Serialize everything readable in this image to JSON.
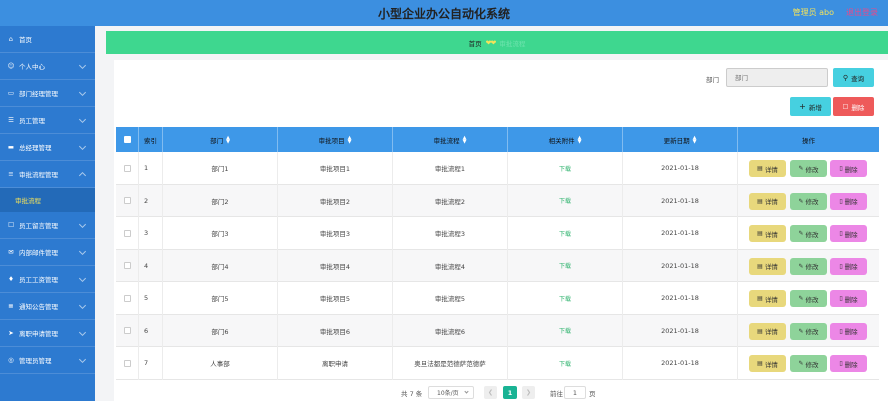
{
  "header": {
    "title": "小型企业办公自动化系统",
    "user": "管理员 abo",
    "logout": "退出登录"
  },
  "sidebar": {
    "items": [
      {
        "label": "首页",
        "icon": "home-icon"
      },
      {
        "label": "个人中心",
        "icon": "user-icon"
      },
      {
        "label": "部门经理管理",
        "icon": "folder-icon"
      },
      {
        "label": "员工管理",
        "icon": "staff-icon"
      },
      {
        "label": "总经理管理",
        "icon": "manager-icon"
      },
      {
        "label": "审批流程管理",
        "icon": "list-icon"
      },
      {
        "label": "员工留言管理",
        "icon": "message-icon"
      },
      {
        "label": "内部邮件管理",
        "icon": "mail-icon"
      },
      {
        "label": "员工工资管理",
        "icon": "salary-icon"
      },
      {
        "label": "通知公告管理",
        "icon": "notice-icon"
      },
      {
        "label": "离职申请管理",
        "icon": "leave-icon"
      },
      {
        "label": "管理员管理",
        "icon": "admin-icon"
      }
    ],
    "sub_item": "审批流程"
  },
  "breadcrumb": {
    "home": "首页",
    "current": "审批流程"
  },
  "search": {
    "label": "部门",
    "placeholder": "部门",
    "button": "查询"
  },
  "actions": {
    "add": "新增",
    "delete": "删除"
  },
  "table": {
    "columns": [
      "索引",
      "部门",
      "审批项目",
      "审批流程",
      "相关附件",
      "更新日期",
      "操作"
    ],
    "rows": [
      {
        "index": "1",
        "dept": "部门1",
        "item": "审批项目1",
        "flow": "审批流程1",
        "file": "下载",
        "date": "2021-01-18"
      },
      {
        "index": "2",
        "dept": "部门2",
        "item": "审批项目2",
        "flow": "审批流程2",
        "file": "下载",
        "date": "2021-01-18"
      },
      {
        "index": "3",
        "dept": "部门3",
        "item": "审批项目3",
        "flow": "审批流程3",
        "file": "下载",
        "date": "2021-01-18"
      },
      {
        "index": "4",
        "dept": "部门4",
        "item": "审批项目4",
        "flow": "审批流程4",
        "file": "下载",
        "date": "2021-01-18"
      },
      {
        "index": "5",
        "dept": "部门5",
        "item": "审批项目5",
        "flow": "审批流程5",
        "file": "下载",
        "date": "2021-01-18"
      },
      {
        "index": "6",
        "dept": "部门6",
        "item": "审批项目6",
        "flow": "审批流程6",
        "file": "下载",
        "date": "2021-01-18"
      },
      {
        "index": "7",
        "dept": "人事部",
        "item": "离职申请",
        "flow": "奥旦法都是范德萨范德萨",
        "file": "下载",
        "date": "2021-01-18"
      }
    ],
    "row_buttons": {
      "detail": "详情",
      "edit": "修改",
      "delete": "删除"
    }
  },
  "pagination": {
    "total": "共 7 条",
    "page_size": "10条/页",
    "current": "1",
    "goto_prefix": "前往",
    "goto_value": "1",
    "goto_suffix": "页"
  },
  "colors": {
    "topbar": "#3c8fe0",
    "sidebar": "#2d7ad0",
    "breadcrumb": "#3ed78f",
    "table_header": "#3e98e8",
    "detail": "#e8d87c",
    "edit": "#8ed39a",
    "delete": "#ec87e6"
  }
}
